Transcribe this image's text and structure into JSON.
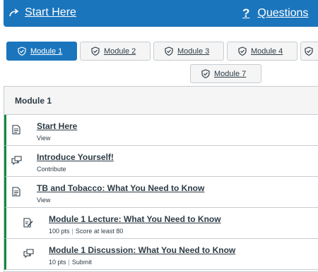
{
  "topbar": {
    "start_label": "Start Here",
    "questions_label": "Questions",
    "question_mark": "?"
  },
  "tabs": [
    {
      "label": "Module 1",
      "active": true
    },
    {
      "label": "Module 2"
    },
    {
      "label": "Module 3"
    },
    {
      "label": "Module 4"
    },
    {
      "label": ""
    },
    {
      "label": "Module 7"
    }
  ],
  "module": {
    "title": "Module 1",
    "items": [
      {
        "title": "Start Here",
        "meta": "View",
        "icon": "page-icon"
      },
      {
        "title": "Introduce Yourself!",
        "meta": "Contribute",
        "icon": "discussion-icon"
      },
      {
        "title": "TB and Tobacco: What You Need to Know",
        "meta": "View",
        "icon": "page-icon"
      },
      {
        "title": "Module 1 Lecture: What You Need to Know",
        "pts": "100 pts",
        "meta": "Score at least 80",
        "icon": "quiz-icon"
      },
      {
        "title": "Module 1 Discussion: What You Need to Know",
        "pts": "10 pts",
        "meta": "Submit",
        "icon": "discussion-icon"
      }
    ]
  },
  "colors": {
    "accent": "#1b75bc",
    "complete_bar": "#14893c"
  }
}
